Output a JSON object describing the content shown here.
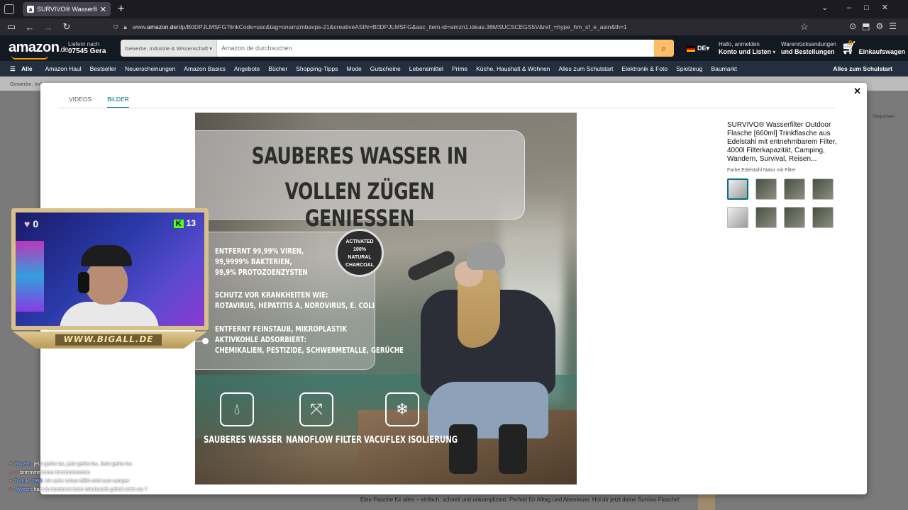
{
  "browser": {
    "tab_title": "SURVIVO® Wasserfilter Outdo",
    "favicon": "a",
    "url_prefix": "www.",
    "url_domain": "amazon.de",
    "url_path": "/dp/B0DPJLMSFG?linkCode=ssc&tag=onamzmbavps-21&creativeASIN=B0DPJLMSFG&asc_item-id=amzn1.ideas.36MSUCSCEGS5V&ref_=hype_hm_sf_e_asin&th=1"
  },
  "amazon": {
    "logo": "amazon",
    "logo_tld": ".de",
    "deliver_line1": "Liefern nach",
    "deliver_line2": "07545 Gera",
    "search_category": "Gewerbe, Industrie & Wissenschaft",
    "search_placeholder": "Amazon.de durchsuchen",
    "lang": "DE",
    "account_line1": "Hallo, anmelden",
    "account_line2": "Konto und Listen",
    "orders_line1": "Warenrücksendungen",
    "orders_line2": "und Bestellungen",
    "cart_count": "0",
    "cart_label": "Einkaufswagen"
  },
  "nav": {
    "all": "Alle",
    "items": [
      "Amazon Haul",
      "Bestseller",
      "Neuerscheinungen",
      "Amazon Basics",
      "Angebote",
      "Bücher",
      "Shopping-Tipps",
      "Mode",
      "Gutscheine",
      "Lebensmittel",
      "Prime",
      "Küche, Haushalt & Wohnen",
      "Alles zum Schulstart",
      "Elektronik & Foto",
      "Spielzeug",
      "Baumarkt"
    ],
    "promo": "Alles zum Schulstart"
  },
  "subbar": "Gewerbe, Ind",
  "sponsored": "Gesponsert",
  "bottom_text": "Eine Flasche für alles – einfach, schnell und unkompliziert. Perfekt für Alltag und Abenteuer. Hol dir jetzt deine Survivo Flasche!",
  "modal": {
    "tab_videos": "VIDEOS",
    "tab_images": "BILDER",
    "product_title": "SURVIVO® Wasserfilter Outdoor Flasche [660ml] Trinkflasche aus Edelstahl mit entnehmbarem Filter, 4000l Filterkapazität, Camping, Wandern, Survival, Reisen...",
    "variant": "Farbe:Edelstahl Natur mit Filter",
    "image": {
      "headline1": "SAUBERES WASSER IN",
      "headline2": "VOLLEN ZÜGEN GENIESSEN",
      "feature1": [
        "ENTFERNT 99,99% VIREN,",
        "99,9999% BAKTERIEN,",
        "99,9% PROTOZOENZYSTEN"
      ],
      "feature2": [
        "SCHUTZ VOR KRANKHEITEN WIE:",
        "ROTAVIRUS, HEPATITIS A, NOROVIRUS, E. COLI"
      ],
      "feature3": [
        "ENTFERNT FEINSTAUB, MIKROPLASTIK",
        "AKTIVKOHLE ADSORBIERT:",
        "CHEMIKALIEN, PESTIZIDE, SCHWERMETALLE, GERÜCHE"
      ],
      "badge_top": "ACTIVATED",
      "badge_mid": "100%",
      "badge_mid2": "NATURAL",
      "badge_bottom": "CHARCOAL",
      "icon1_label": "SAUBERES WASSER",
      "icon2_label": "NANOFLOW FILTER",
      "icon3_label": "VACUFLEX ISOLIERUNG"
    }
  },
  "overlay": {
    "hearts": "0",
    "kick_count": "13",
    "kick_letter": "K",
    "banner": "WWW.BIGALL.DE"
  },
  "chat": [
    {
      "user": "Voyzen",
      "text": ": jetzt gehts los, jetzt gehts los, Jetzt gehts los"
    },
    {
      "user": "",
      "text": "brrrrmmmmmm brrrrmmmmmm"
    },
    {
      "user": "Toduk_1986",
      "text": ": ich sehe schon MBA wird zum camper"
    },
    {
      "user": "Voyzen",
      "text": ": hast du bestimmt beim Woolworth geholt nicht wa ?"
    }
  ]
}
